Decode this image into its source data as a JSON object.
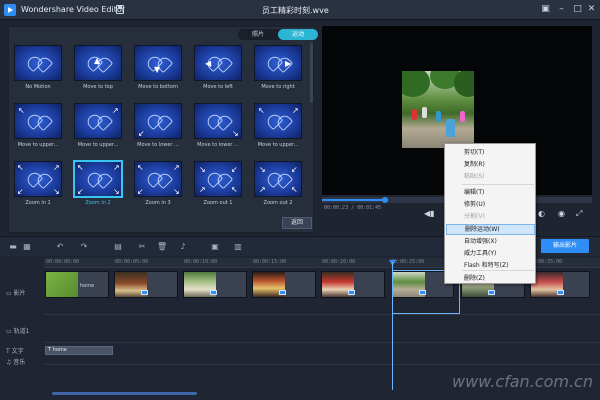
{
  "app": {
    "title": "Wondershare Video Editor",
    "file": "员工精彩时刻.wve"
  },
  "library": {
    "tabs": [
      "照片",
      "运动"
    ],
    "active_tab": "运动",
    "items": [
      {
        "label": "No Motion",
        "icon": "no-motion"
      },
      {
        "label": "Move to top",
        "icon": "arrow-up"
      },
      {
        "label": "Move to bottom",
        "icon": "arrow-down"
      },
      {
        "label": "Move to left",
        "icon": "arrow-left"
      },
      {
        "label": "Move to right",
        "icon": "arrow-right"
      },
      {
        "label": "Move to upper...",
        "icon": "arrow-upper-left"
      },
      {
        "label": "Move to upper...",
        "icon": "arrow-upper-right"
      },
      {
        "label": "Move to lower ...",
        "icon": "arrow-lower-left"
      },
      {
        "label": "Move to lower ...",
        "icon": "arrow-lower-right"
      },
      {
        "label": "Move to upper...",
        "icon": "arrow-upper"
      },
      {
        "label": "Zoom in 1",
        "icon": "zoom-in"
      },
      {
        "label": "Zoom in 2",
        "icon": "zoom-in",
        "selected": true
      },
      {
        "label": "Zoom in 3",
        "icon": "zoom-in"
      },
      {
        "label": "Zoom out 1",
        "icon": "zoom-out"
      },
      {
        "label": "Zoom out 2",
        "icon": "zoom-out"
      }
    ],
    "back_label": "返回"
  },
  "preview": {
    "time": "00:00:23 / 00:01:45"
  },
  "toolbar": {
    "export_label": "输出影片"
  },
  "timeline": {
    "ticks": [
      "00:00:00:00",
      "00:00:05:00",
      "00:00:10:00",
      "00:00:15:00",
      "00:00:20:00",
      "00:00:25:00",
      "00:00:30:00",
      "00:00:35:00"
    ],
    "tracks": {
      "video": "影片",
      "overlay": "轨道1",
      "text": "文字",
      "music": "音乐"
    },
    "first_clip_label": "home",
    "text_clip_label": "home"
  },
  "context_menu": {
    "items": [
      {
        "label": "剪切(T)",
        "enabled": true
      },
      {
        "label": "复制(R)",
        "enabled": true
      },
      {
        "label": "粘贴(S)",
        "enabled": false
      },
      {
        "label": "编辑(T)",
        "enabled": true
      },
      {
        "label": "修剪(U)",
        "enabled": true
      },
      {
        "label": "分割(V)",
        "enabled": false
      },
      {
        "label": "删除运动(W)",
        "enabled": true,
        "highlighted": true
      },
      {
        "label": "自动增强(X)",
        "enabled": true
      },
      {
        "label": "威力工具(Y)",
        "enabled": true
      },
      {
        "label": "Flash 和特写(Z)",
        "enabled": true
      },
      {
        "label": "删除(Z)",
        "enabled": true
      }
    ]
  },
  "watermark": "www.cfan.com.cn"
}
